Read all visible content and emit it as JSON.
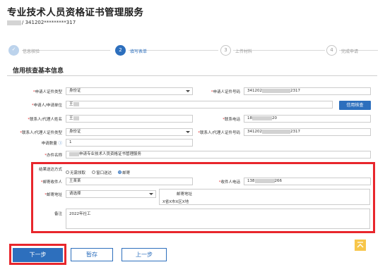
{
  "page_title": "专业技术人员资格证书管理服务",
  "id_line": {
    "suffix": "/ 341202*********317"
  },
  "steps": [
    {
      "number": "✓",
      "label": "信息核验",
      "state": "done"
    },
    {
      "number": "2",
      "label": "填写表单",
      "state": "active"
    },
    {
      "number": "3",
      "label": "上传材料",
      "state": "pending"
    },
    {
      "number": "4",
      "label": "完成申请",
      "state": "pending"
    }
  ],
  "section_title": "信用核查基本信息",
  "form": {
    "applicant_id_type": {
      "label": "申请人证件类型",
      "value": "身份证"
    },
    "applicant_id_number": {
      "label": "申请人证件号码",
      "value_prefix": "341202",
      "value_suffix": "2317"
    },
    "applicant_name": {
      "label": "申请人/申请单位",
      "value": "王"
    },
    "credit_check_button": "信用核查",
    "contact_name": {
      "label": "联系人/代理人姓名",
      "value": "王"
    },
    "contact_phone": {
      "label": "联系电话",
      "value_prefix": "18",
      "value_suffix": "20"
    },
    "contact_id_type": {
      "label": "联系人/代理人证件类型",
      "value": "身份证"
    },
    "contact_id_number": {
      "label": "联系人/代理人证件号码",
      "value_prefix": "341202",
      "value_suffix": "2317"
    },
    "apply_count": {
      "label": "申请数量",
      "value": "1"
    },
    "matter_name": {
      "label": "办件名称",
      "value": "申请专业技术人员资格证书管理服务"
    },
    "delivery_method": {
      "label": "结果送达方式",
      "options": [
        "无需领取",
        "窗口送达",
        "邮寄"
      ],
      "selected": "邮寄"
    },
    "recipient": {
      "label": "邮寄收件人",
      "value": "王某某"
    },
    "recipient_phone": {
      "label": "收件人电话",
      "value_prefix": "138",
      "value_suffix": "266"
    },
    "mail_address": {
      "label": "邮寄地址",
      "placeholder": "请选择"
    },
    "mail_address_detail": {
      "title": "邮寄地址",
      "value": "X省X市X区X地"
    },
    "remark": {
      "label": "备注",
      "value": "2022年社工"
    }
  },
  "buttons": {
    "next": "下一步",
    "save": "暂存",
    "prev": "上一步"
  },
  "colors": {
    "primary": "#2d6fbd",
    "highlight": "#e8262c",
    "required": "#e03030",
    "back_to_top": "#f7c64a"
  }
}
